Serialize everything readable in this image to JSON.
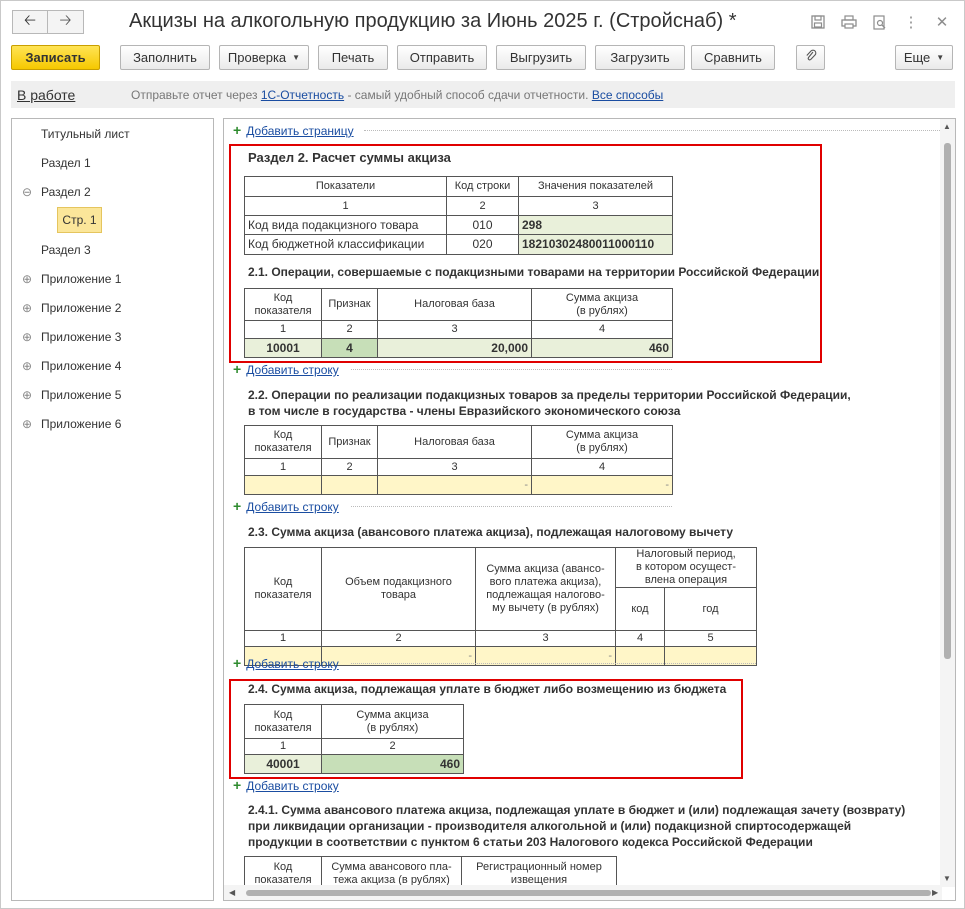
{
  "window": {
    "title": "Акцизы на алкогольную продукцию за Июнь 2025 г. (Стройснаб) *"
  },
  "toolbar": {
    "save": "Записать",
    "fill": "Заполнить",
    "check": "Проверка",
    "print": "Печать",
    "send": "Отправить",
    "unload": "Выгрузить",
    "load": "Загрузить",
    "compare": "Сравнить",
    "more": "Еще"
  },
  "info": {
    "status": "В работе",
    "text_before": "Отправьте отчет через",
    "link1": "1С-Отчетность",
    "text_after": "- самый удобный способ сдачи отчетности.",
    "link2": "Все способы"
  },
  "tree": {
    "items": [
      "Титульный лист",
      "Раздел 1",
      "Раздел 2",
      "Стр. 1",
      "Раздел 3",
      "Приложение 1",
      "Приложение 2",
      "Приложение 3",
      "Приложение 4",
      "Приложение 5",
      "Приложение 6"
    ]
  },
  "content": {
    "add_page": "Добавить страницу",
    "add_row": "Добавить строку",
    "section_title": "Раздел 2. Расчет суммы акциза",
    "t1": {
      "h": [
        "Показатели",
        "Код строки",
        "Значения показателей"
      ],
      "n": [
        "1",
        "2",
        "3"
      ],
      "r1": [
        "Код вида подакцизного товара",
        "010",
        "298"
      ],
      "r2": [
        "Код бюджетной классификации",
        "020",
        "18210302480011000110"
      ]
    },
    "s21": {
      "title": "2.1. Операции, совершаемые с подакцизными товарами на территории Российской Федерации"
    },
    "s22": {
      "title1": "2.2. Операции по реализации подакцизных товаров за пределы территории Российской Федерации,",
      "title2": "в том числе в государства - члены Евразийского экономического союза"
    },
    "hdr4": {
      "code1": "Код",
      "code2": "показателя",
      "sign": "Признак",
      "base": "Налоговая база",
      "sum1": "Сумма акциза",
      "sum2": "(в рублях)",
      "n": [
        "1",
        "2",
        "3",
        "4"
      ]
    },
    "t21_row": [
      "10001",
      "4",
      "20,000",
      "460"
    ],
    "t22_row": [
      "",
      "",
      "-",
      "-"
    ],
    "s23": {
      "title": "2.3. Сумма акциза (авансового платежа акциза), подлежащая налоговому вычету",
      "h_code1": "Код",
      "h_code2": "показателя",
      "h_vol1": "Объем подакцизного",
      "h_vol2": "товара",
      "h_sum": [
        "Сумма акциза (авансо-",
        "вого платежа акциза),",
        "подлежащая налогово-",
        "му вычету (в рублях)"
      ],
      "h_per": [
        "Налоговый период,",
        "в котором осущест-",
        "влена операция"
      ],
      "h_code": "код",
      "h_year": "год",
      "n": [
        "1",
        "2",
        "3",
        "4",
        "5"
      ],
      "row": [
        "",
        "-",
        "-",
        "",
        ""
      ]
    },
    "s24": {
      "title": "2.4. Сумма акциза, подлежащая уплате в бюджет либо возмещению из бюджета",
      "n": [
        "1",
        "2"
      ],
      "row": [
        "40001",
        "460"
      ]
    },
    "s241": {
      "title1": "2.4.1. Сумма авансового платежа акциза, подлежащая уплате в бюджет и (или) подлежащая зачету (возврату)",
      "title2": "при ликвидации организации - производителя алкогольной и (или) подакцизной спиртосодержащей",
      "title3": "продукции в соответствии с пунктом 6 статьи 203 Налогового кодекса Российской Федерации",
      "h_sum1": "Сумма авансового пла-",
      "h_sum2": "тежа акциза (в рублях)",
      "h_reg1": "Регистрационный номер",
      "h_reg2": "извещения"
    }
  }
}
